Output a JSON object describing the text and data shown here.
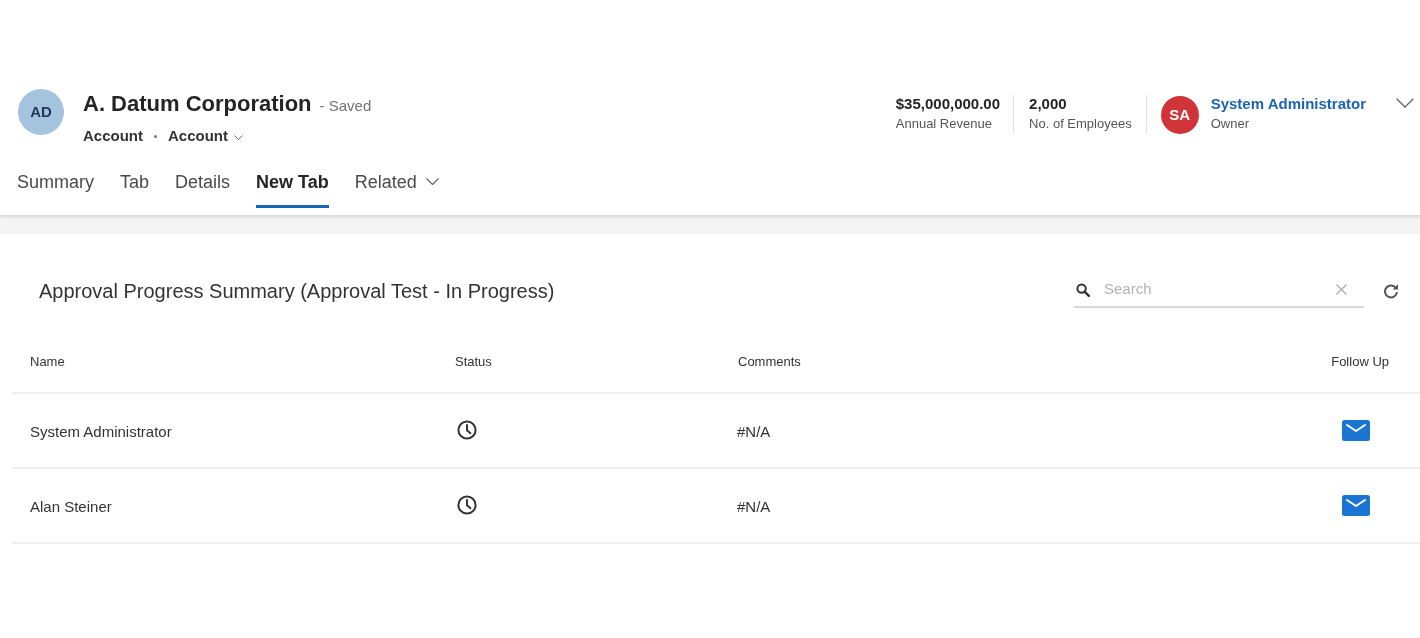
{
  "record": {
    "initials": "AD",
    "title": "A. Datum Corporation",
    "save_status": "- Saved",
    "entity": "Account",
    "form": "Account"
  },
  "header_fields": [
    {
      "value": "$35,000,000.00",
      "label": "Annual Revenue"
    },
    {
      "value": "2,000",
      "label": "No. of Employees"
    }
  ],
  "owner": {
    "initials": "SA",
    "name": "System Administrator",
    "label": "Owner"
  },
  "tabs": [
    {
      "label": "Summary",
      "selected": false,
      "kind": "plain"
    },
    {
      "label": "Tab",
      "selected": false,
      "kind": "plain"
    },
    {
      "label": "Details",
      "selected": false,
      "kind": "plain"
    },
    {
      "label": "New Tab",
      "selected": true,
      "kind": "plain"
    },
    {
      "label": "Related",
      "selected": false,
      "kind": "menu"
    }
  ],
  "panel": {
    "title": "Approval Progress Summary (Approval Test - In Progress)",
    "search": {
      "placeholder": "Search"
    },
    "table": {
      "columns": [
        "Name",
        "Status",
        "Comments",
        "Follow Up"
      ],
      "rows": [
        {
          "name": "System Administrator",
          "comments": "#N/A"
        },
        {
          "name": "Alan Steiner",
          "comments": "#N/A"
        }
      ]
    }
  }
}
